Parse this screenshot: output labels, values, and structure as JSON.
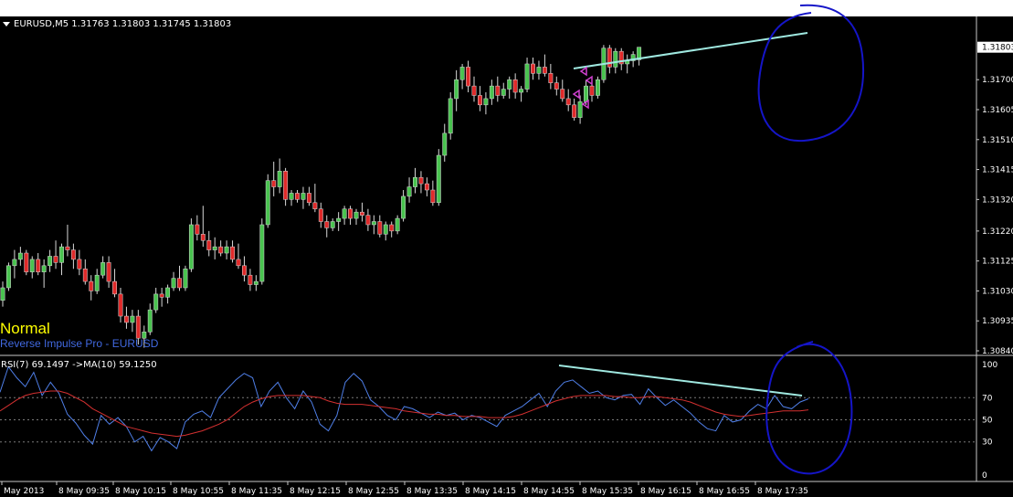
{
  "symbol_header": "EURUSD,M5  1.31763 1.31803 1.31745 1.31803",
  "current_price_label": "1.31803",
  "price_axis_labels": [
    "1.31700",
    "1.31605",
    "1.31510",
    "1.31415",
    "1.31320",
    "1.31220",
    "1.31125",
    "1.31030",
    "1.30935",
    "1.30840"
  ],
  "regime_label": "Normal",
  "indicator_name": "Reverse Impulse Pro - EURUSD",
  "rsi_header": "RSI(7) 69.1497   ->MA(10) 59.1250",
  "rsi_axis_labels": [
    "100",
    "70",
    "50",
    "30",
    "0"
  ],
  "time_axis_labels": [
    "May 2013",
    "8 May 09:35",
    "8 May 10:15",
    "8 May 10:55",
    "8 May 11:35",
    "8 May 12:15",
    "8 May 12:55",
    "8 May 13:35",
    "8 May 14:15",
    "8 May 14:55",
    "8 May 15:35",
    "8 May 16:15",
    "8 May 16:55",
    "8 May 17:35"
  ],
  "colors": {
    "background": "#000000",
    "bull_candle": "#49c34f",
    "bear_candle": "#e02a2a",
    "rsi_line": "#4f7fe8",
    "rsi_ma_line": "#d43030",
    "trendline": "#9fe8e0",
    "annotation_circle": "#1515c8",
    "arrow_marker": "#d040d0",
    "regime_label": "#ffff00",
    "indicator_label": "#4169e1"
  },
  "chart_data": {
    "type": "candlestick",
    "symbol": "EURUSD",
    "timeframe": "M5",
    "ohlc_last": {
      "open": 1.31763,
      "high": 1.31803,
      "low": 1.31745,
      "close": 1.31803
    },
    "price_range": [
      1.3084,
      1.3185
    ],
    "candles": [
      {
        "o": 1.31,
        "h": 1.3106,
        "l": 1.3098,
        "c": 1.3104
      },
      {
        "o": 1.3104,
        "h": 1.3112,
        "l": 1.3103,
        "c": 1.3111
      },
      {
        "o": 1.3111,
        "h": 1.3116,
        "l": 1.3107,
        "c": 1.3113
      },
      {
        "o": 1.3113,
        "h": 1.3117,
        "l": 1.3111,
        "c": 1.3115
      },
      {
        "o": 1.3115,
        "h": 1.3116,
        "l": 1.3108,
        "c": 1.3109
      },
      {
        "o": 1.3109,
        "h": 1.3114,
        "l": 1.3107,
        "c": 1.3113
      },
      {
        "o": 1.3113,
        "h": 1.3115,
        "l": 1.3108,
        "c": 1.3109
      },
      {
        "o": 1.3109,
        "h": 1.3113,
        "l": 1.3104,
        "c": 1.3111
      },
      {
        "o": 1.3111,
        "h": 1.3116,
        "l": 1.3109,
        "c": 1.3114
      },
      {
        "o": 1.3114,
        "h": 1.3119,
        "l": 1.311,
        "c": 1.3112
      },
      {
        "o": 1.3112,
        "h": 1.3118,
        "l": 1.3108,
        "c": 1.3117
      },
      {
        "o": 1.3117,
        "h": 1.3124,
        "l": 1.3114,
        "c": 1.3116
      },
      {
        "o": 1.3116,
        "h": 1.3118,
        "l": 1.311,
        "c": 1.3113
      },
      {
        "o": 1.3113,
        "h": 1.3116,
        "l": 1.3108,
        "c": 1.311
      },
      {
        "o": 1.311,
        "h": 1.3113,
        "l": 1.3105,
        "c": 1.3106
      },
      {
        "o": 1.3106,
        "h": 1.3108,
        "l": 1.31,
        "c": 1.3103
      },
      {
        "o": 1.3103,
        "h": 1.311,
        "l": 1.3102,
        "c": 1.3108
      },
      {
        "o": 1.3108,
        "h": 1.3114,
        "l": 1.3107,
        "c": 1.3112
      },
      {
        "o": 1.3112,
        "h": 1.3114,
        "l": 1.3104,
        "c": 1.3106
      },
      {
        "o": 1.3106,
        "h": 1.311,
        "l": 1.3101,
        "c": 1.3102
      },
      {
        "o": 1.3102,
        "h": 1.3104,
        "l": 1.3093,
        "c": 1.3095
      },
      {
        "o": 1.3095,
        "h": 1.3098,
        "l": 1.3091,
        "c": 1.3093
      },
      {
        "o": 1.3093,
        "h": 1.3097,
        "l": 1.309,
        "c": 1.3095
      },
      {
        "o": 1.3095,
        "h": 1.3097,
        "l": 1.3086,
        "c": 1.3088
      },
      {
        "o": 1.3088,
        "h": 1.3092,
        "l": 1.3085,
        "c": 1.309
      },
      {
        "o": 1.309,
        "h": 1.3099,
        "l": 1.3089,
        "c": 1.3097
      },
      {
        "o": 1.3097,
        "h": 1.3104,
        "l": 1.3096,
        "c": 1.3102
      },
      {
        "o": 1.3102,
        "h": 1.3104,
        "l": 1.3098,
        "c": 1.3101
      },
      {
        "o": 1.3101,
        "h": 1.3105,
        "l": 1.3099,
        "c": 1.3104
      },
      {
        "o": 1.3104,
        "h": 1.3109,
        "l": 1.3103,
        "c": 1.3107
      },
      {
        "o": 1.3107,
        "h": 1.3111,
        "l": 1.3103,
        "c": 1.3104
      },
      {
        "o": 1.3104,
        "h": 1.3111,
        "l": 1.3103,
        "c": 1.311
      },
      {
        "o": 1.311,
        "h": 1.3126,
        "l": 1.3109,
        "c": 1.3124
      },
      {
        "o": 1.3124,
        "h": 1.3127,
        "l": 1.3119,
        "c": 1.3121
      },
      {
        "o": 1.3121,
        "h": 1.313,
        "l": 1.3117,
        "c": 1.3119
      },
      {
        "o": 1.3119,
        "h": 1.3122,
        "l": 1.3114,
        "c": 1.3116
      },
      {
        "o": 1.3116,
        "h": 1.312,
        "l": 1.3113,
        "c": 1.3117
      },
      {
        "o": 1.3117,
        "h": 1.3119,
        "l": 1.3114,
        "c": 1.3115
      },
      {
        "o": 1.3115,
        "h": 1.3119,
        "l": 1.3113,
        "c": 1.3117
      },
      {
        "o": 1.3117,
        "h": 1.3119,
        "l": 1.3112,
        "c": 1.3113
      },
      {
        "o": 1.3113,
        "h": 1.3118,
        "l": 1.311,
        "c": 1.3111
      },
      {
        "o": 1.3111,
        "h": 1.3114,
        "l": 1.3106,
        "c": 1.3108
      },
      {
        "o": 1.3108,
        "h": 1.311,
        "l": 1.3103,
        "c": 1.3105
      },
      {
        "o": 1.3105,
        "h": 1.3108,
        "l": 1.3103,
        "c": 1.3106
      },
      {
        "o": 1.3106,
        "h": 1.3126,
        "l": 1.3105,
        "c": 1.3124
      },
      {
        "o": 1.3124,
        "h": 1.314,
        "l": 1.3123,
        "c": 1.3138
      },
      {
        "o": 1.3138,
        "h": 1.3144,
        "l": 1.3133,
        "c": 1.3136
      },
      {
        "o": 1.3136,
        "h": 1.3145,
        "l": 1.3134,
        "c": 1.3141
      },
      {
        "o": 1.3141,
        "h": 1.3142,
        "l": 1.313,
        "c": 1.3132
      },
      {
        "o": 1.3132,
        "h": 1.3135,
        "l": 1.313,
        "c": 1.3134
      },
      {
        "o": 1.3134,
        "h": 1.3135,
        "l": 1.3131,
        "c": 1.3132
      },
      {
        "o": 1.3132,
        "h": 1.3136,
        "l": 1.3129,
        "c": 1.3134
      },
      {
        "o": 1.3134,
        "h": 1.3136,
        "l": 1.313,
        "c": 1.3131
      },
      {
        "o": 1.3131,
        "h": 1.3137,
        "l": 1.3128,
        "c": 1.3129
      },
      {
        "o": 1.3129,
        "h": 1.3131,
        "l": 1.3123,
        "c": 1.3125
      },
      {
        "o": 1.3125,
        "h": 1.3127,
        "l": 1.312,
        "c": 1.3123
      },
      {
        "o": 1.3123,
        "h": 1.3126,
        "l": 1.3122,
        "c": 1.3125
      },
      {
        "o": 1.3125,
        "h": 1.3128,
        "l": 1.3122,
        "c": 1.3126
      },
      {
        "o": 1.3126,
        "h": 1.313,
        "l": 1.3124,
        "c": 1.3129
      },
      {
        "o": 1.3129,
        "h": 1.313,
        "l": 1.3124,
        "c": 1.3126
      },
      {
        "o": 1.3126,
        "h": 1.3129,
        "l": 1.3124,
        "c": 1.3128
      },
      {
        "o": 1.3128,
        "h": 1.3131,
        "l": 1.3125,
        "c": 1.3127
      },
      {
        "o": 1.3127,
        "h": 1.3129,
        "l": 1.3122,
        "c": 1.3124
      },
      {
        "o": 1.3124,
        "h": 1.3127,
        "l": 1.3121,
        "c": 1.3125
      },
      {
        "o": 1.3125,
        "h": 1.3127,
        "l": 1.312,
        "c": 1.3121
      },
      {
        "o": 1.3121,
        "h": 1.3125,
        "l": 1.3119,
        "c": 1.3124
      },
      {
        "o": 1.3124,
        "h": 1.3125,
        "l": 1.312,
        "c": 1.3122
      },
      {
        "o": 1.3122,
        "h": 1.3127,
        "l": 1.3121,
        "c": 1.3126
      },
      {
        "o": 1.3126,
        "h": 1.3135,
        "l": 1.3125,
        "c": 1.3133
      },
      {
        "o": 1.3133,
        "h": 1.3139,
        "l": 1.3131,
        "c": 1.3136
      },
      {
        "o": 1.3136,
        "h": 1.3142,
        "l": 1.3134,
        "c": 1.3139
      },
      {
        "o": 1.3139,
        "h": 1.3141,
        "l": 1.3134,
        "c": 1.3137
      },
      {
        "o": 1.3137,
        "h": 1.3139,
        "l": 1.3133,
        "c": 1.3135
      },
      {
        "o": 1.3135,
        "h": 1.3138,
        "l": 1.313,
        "c": 1.3131
      },
      {
        "o": 1.3131,
        "h": 1.3148,
        "l": 1.313,
        "c": 1.3146
      },
      {
        "o": 1.3146,
        "h": 1.3156,
        "l": 1.3144,
        "c": 1.3153
      },
      {
        "o": 1.3153,
        "h": 1.3166,
        "l": 1.3151,
        "c": 1.3164
      },
      {
        "o": 1.3164,
        "h": 1.3173,
        "l": 1.316,
        "c": 1.317
      },
      {
        "o": 1.317,
        "h": 1.3175,
        "l": 1.3167,
        "c": 1.3174
      },
      {
        "o": 1.3174,
        "h": 1.3176,
        "l": 1.3166,
        "c": 1.3168
      },
      {
        "o": 1.3168,
        "h": 1.3171,
        "l": 1.3163,
        "c": 1.3165
      },
      {
        "o": 1.3165,
        "h": 1.3168,
        "l": 1.316,
        "c": 1.3162
      },
      {
        "o": 1.3162,
        "h": 1.3166,
        "l": 1.3159,
        "c": 1.3164
      },
      {
        "o": 1.3164,
        "h": 1.317,
        "l": 1.3162,
        "c": 1.3168
      },
      {
        "o": 1.3168,
        "h": 1.3171,
        "l": 1.3163,
        "c": 1.3165
      },
      {
        "o": 1.3165,
        "h": 1.3169,
        "l": 1.3164,
        "c": 1.3167
      },
      {
        "o": 1.3167,
        "h": 1.3171,
        "l": 1.3164,
        "c": 1.317
      },
      {
        "o": 1.317,
        "h": 1.3172,
        "l": 1.3164,
        "c": 1.3166
      },
      {
        "o": 1.3166,
        "h": 1.3168,
        "l": 1.3163,
        "c": 1.3167
      },
      {
        "o": 1.3167,
        "h": 1.3177,
        "l": 1.3166,
        "c": 1.3175
      },
      {
        "o": 1.3175,
        "h": 1.3177,
        "l": 1.317,
        "c": 1.3172
      },
      {
        "o": 1.3172,
        "h": 1.3176,
        "l": 1.317,
        "c": 1.3174
      },
      {
        "o": 1.3174,
        "h": 1.3178,
        "l": 1.3171,
        "c": 1.3172
      },
      {
        "o": 1.3172,
        "h": 1.3175,
        "l": 1.3167,
        "c": 1.3169
      },
      {
        "o": 1.3169,
        "h": 1.3171,
        "l": 1.3165,
        "c": 1.3167
      },
      {
        "o": 1.3167,
        "h": 1.317,
        "l": 1.3163,
        "c": 1.3164
      },
      {
        "o": 1.3164,
        "h": 1.3167,
        "l": 1.316,
        "c": 1.3162
      },
      {
        "o": 1.3162,
        "h": 1.3164,
        "l": 1.3157,
        "c": 1.3158
      },
      {
        "o": 1.3158,
        "h": 1.3165,
        "l": 1.3156,
        "c": 1.3163
      },
      {
        "o": 1.3163,
        "h": 1.317,
        "l": 1.3162,
        "c": 1.3168
      },
      {
        "o": 1.3168,
        "h": 1.317,
        "l": 1.3163,
        "c": 1.3165
      },
      {
        "o": 1.3165,
        "h": 1.3171,
        "l": 1.3164,
        "c": 1.317
      },
      {
        "o": 1.317,
        "h": 1.3181,
        "l": 1.3169,
        "c": 1.318
      },
      {
        "o": 1.318,
        "h": 1.3181,
        "l": 1.3172,
        "c": 1.3174
      },
      {
        "o": 1.3174,
        "h": 1.318,
        "l": 1.3172,
        "c": 1.3179
      },
      {
        "o": 1.3179,
        "h": 1.318,
        "l": 1.3173,
        "c": 1.3175
      },
      {
        "o": 1.3175,
        "h": 1.3178,
        "l": 1.3172,
        "c": 1.3176
      },
      {
        "o": 1.3176,
        "h": 1.3179,
        "l": 1.3174,
        "c": 1.3178
      },
      {
        "o": 1.31763,
        "h": 1.31803,
        "l": 1.31745,
        "c": 1.31803
      }
    ],
    "rsi": {
      "period": 7,
      "value": 69.1497,
      "ma_period": 10,
      "ma_value": 59.125,
      "levels": [
        70,
        50,
        30
      ],
      "range": [
        0,
        100
      ],
      "values": [
        75,
        98,
        88,
        80,
        93,
        72,
        84,
        74,
        55,
        47,
        36,
        28,
        54,
        46,
        52,
        44,
        30,
        35,
        22,
        34,
        30,
        24,
        48,
        55,
        58,
        52,
        70,
        78,
        86,
        92,
        88,
        62,
        76,
        84,
        70,
        60,
        76,
        66,
        46,
        40,
        54,
        84,
        92,
        85,
        68,
        62,
        54,
        50,
        62,
        60,
        56,
        52,
        57,
        54,
        56,
        50,
        54,
        52,
        48,
        44,
        54,
        58,
        62,
        68,
        74,
        62,
        76,
        84,
        86,
        80,
        74,
        76,
        70,
        68,
        72,
        73,
        64,
        78,
        70,
        63,
        68,
        62,
        56,
        48,
        42,
        40,
        54,
        48,
        50,
        58,
        64,
        60,
        72,
        62,
        60,
        66,
        69
      ],
      "ma_values": [
        58,
        63,
        68,
        72,
        74,
        75,
        76,
        76,
        74,
        70,
        66,
        60,
        56,
        52,
        48,
        44,
        42,
        40,
        38,
        37,
        36,
        35,
        36,
        38,
        40,
        43,
        46,
        50,
        56,
        62,
        66,
        69,
        71,
        72,
        72,
        72,
        72,
        71,
        70,
        67,
        65,
        64,
        64,
        64,
        63,
        62,
        61,
        60,
        58,
        57,
        56,
        55,
        55,
        54,
        54,
        53,
        53,
        53,
        52,
        52,
        52,
        53,
        55,
        58,
        61,
        64,
        67,
        69,
        71,
        72,
        72,
        72,
        72,
        71,
        71,
        70,
        70,
        71,
        71,
        70,
        69,
        68,
        66,
        63,
        60,
        57,
        55,
        54,
        53,
        54,
        55,
        56,
        57,
        58,
        58,
        58,
        59
      ]
    },
    "drawings": [
      "trendline connecting price highs",
      "trendline connecting RSI highs (bearish divergence)",
      "hand-drawn circle around latest price candles",
      "hand-drawn circle around latest RSI"
    ]
  }
}
